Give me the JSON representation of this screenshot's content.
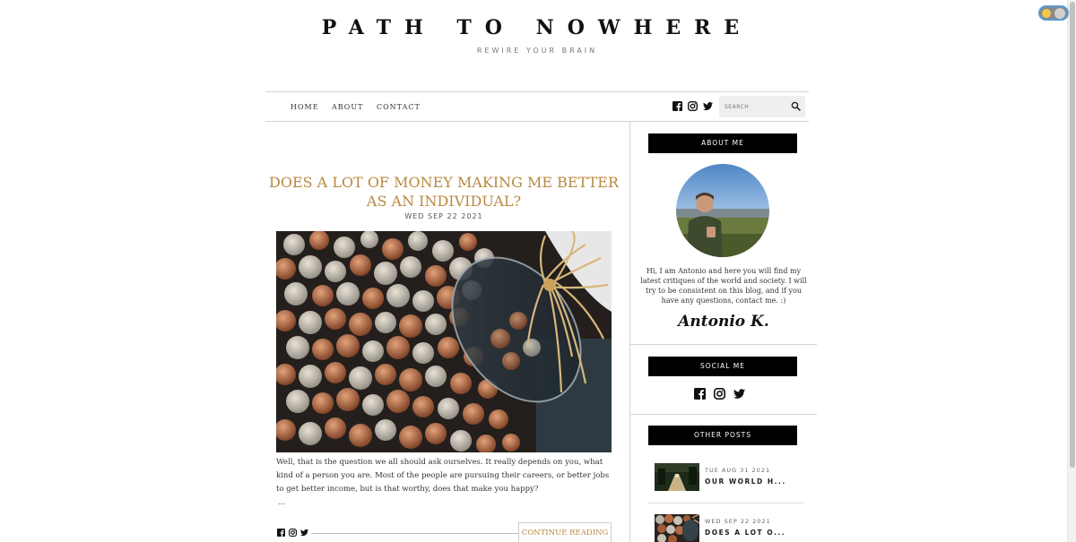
{
  "header": {
    "title": "PATH TO NOWHERE",
    "tagline": "REWIRE YOUR BRAIN"
  },
  "theme_toggle": {
    "icon": "sun-moon-toggle-icon"
  },
  "nav": {
    "items": [
      {
        "label": "HOME"
      },
      {
        "label": "ABOUT"
      },
      {
        "label": "CONTACT"
      }
    ],
    "social_icons": [
      "facebook-icon",
      "instagram-icon",
      "twitter-icon"
    ],
    "search": {
      "placeholder": "SEARCH",
      "value": "",
      "icon": "search-icon"
    }
  },
  "post": {
    "title": "DOES A LOT OF MONEY MAKING ME BETTER AS AN INDIVIDUAL?",
    "date": "WED SEP 22 2021",
    "excerpt": "Well, that is the question we all should ask ourselves. It really depends on you, what kind of a person you are. Most of the people are pursuing their careers, or better jobs to get better income, but is that worthy, does that make you happy?",
    "ellipsis": "...",
    "continue_label": "CONTINUE READING",
    "share_icons": [
      "facebook-icon",
      "instagram-icon",
      "twitter-icon"
    ]
  },
  "sidebar": {
    "about": {
      "heading": "ABOUT ME",
      "text": "Hi, I am Antonio and here you will find my latest critiques of the world and society. I will try to be consistent on this blog, and if you have any questions, contact me. :)",
      "signature": "Antonio K."
    },
    "social": {
      "heading": "SOCIAL ME",
      "icons": [
        "facebook-icon",
        "instagram-icon",
        "twitter-icon"
      ]
    },
    "other_posts": {
      "heading": "OTHER POSTS",
      "items": [
        {
          "date": "TUE AUG 31 2021",
          "title": "OUR WORLD H..."
        },
        {
          "date": "WED SEP 22 2021",
          "title": "DOES A LOT O..."
        }
      ]
    }
  },
  "colors": {
    "accent": "#b8893f",
    "heading_bg": "#000000",
    "border": "#d4d4d4"
  }
}
